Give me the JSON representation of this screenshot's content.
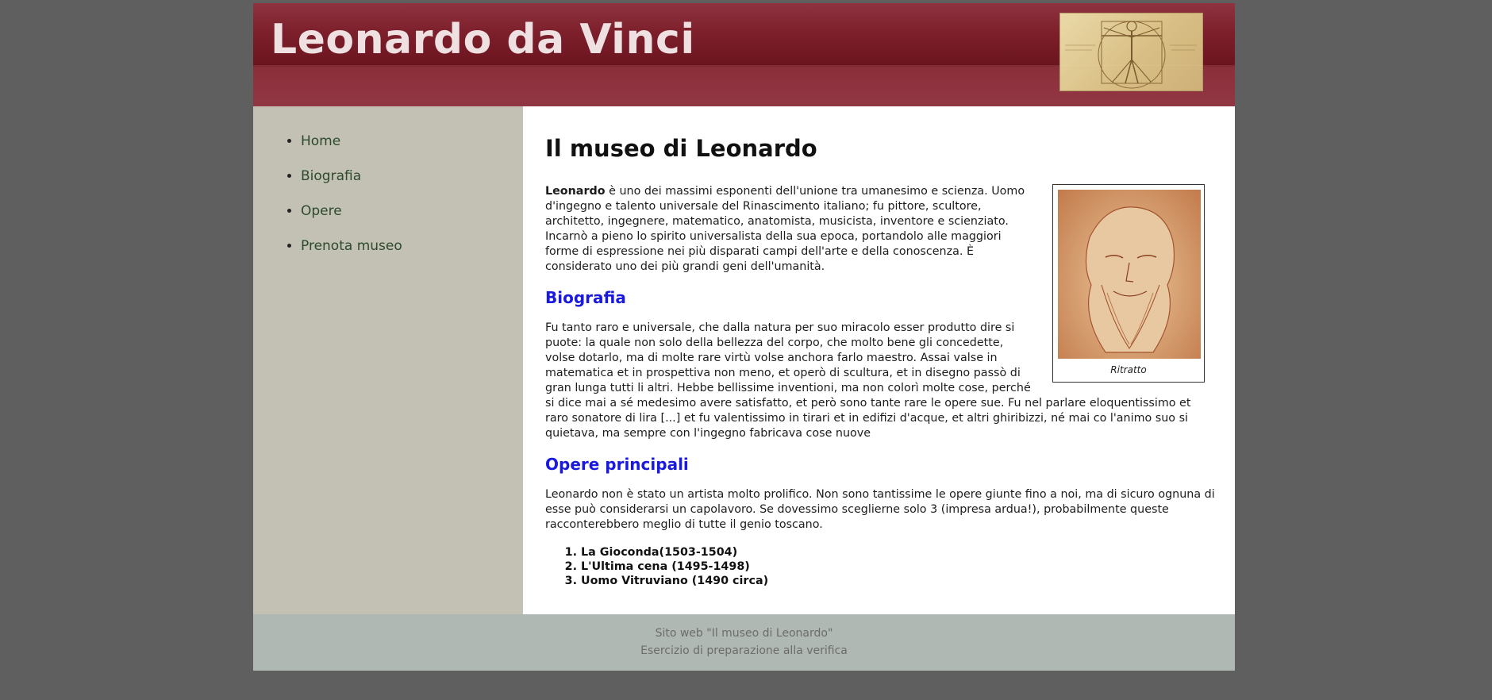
{
  "header": {
    "title": "Leonardo da Vinci"
  },
  "nav": {
    "items": [
      {
        "label": "Home"
      },
      {
        "label": "Biografia"
      },
      {
        "label": "Opere"
      },
      {
        "label": "Prenota museo"
      }
    ]
  },
  "main": {
    "title": "Il museo di Leonardo",
    "intro_bold": "Leonardo",
    "intro_text": " è uno dei massimi esponenti dell'unione tra umanesimo e scienza. Uomo d'ingegno e talento universale del Rinascimento italiano; fu pittore, scultore, architetto, ingegnere, matematico, anatomista, musicista, inventore e scienziato. Incarnò a pieno lo spirito universalista della sua epoca, portandolo alle maggiori forme di espressione nei più disparati campi dell'arte e della conoscenza. È considerato uno dei più grandi geni dell'umanità.",
    "portrait_caption": "Ritratto",
    "bio_heading": "Biografia",
    "bio_text": "Fu tanto raro e universale, che dalla natura per suo miracolo esser produtto dire si puote: la quale non solo della bellezza del corpo, che molto bene gli concedette, volse dotarlo, ma di molte rare virtù volse anchora farlo maestro. Assai valse in matematica et in prospettiva non meno, et operò di scultura, et in disegno passò di gran lunga tutti li altri. Hebbe bellissime inventioni, ma non colorì molte cose, perché si dice mai a sé medesimo avere satisfatto, et però sono tante rare le opere sue. Fu nel parlare eloquentissimo et raro sonatore di lira [...] et fu valentissimo in tirari et in edifizi d'acque, et altri ghiribizzi, né mai co l'animo suo si quietava, ma sempre con l'ingegno fabricava cose nuove",
    "works_heading": "Opere principali",
    "works_text": "Leonardo non è stato un artista molto prolifico. Non sono tantissime le opere giunte fino a noi, ma di sicuro ognuna di esse può considerarsi un capolavoro. Se dovessimo sceglierne solo 3 (impresa ardua!), probabilmente queste racconterebbero meglio di tutte il genio toscano.",
    "works": [
      "La Gioconda(1503-1504)",
      "L'Ultima cena (1495-1498)",
      "Uomo Vitruviano (1490 circa)"
    ]
  },
  "footer": {
    "line1": "Sito web \"Il museo di Leonardo\"",
    "line2": "Esercizio di preparazione alla verifica"
  },
  "colors": {
    "background": "#5f5f5f",
    "header": "#7c1f2b",
    "sidebar": "#c3c1b4",
    "heading_blue": "#1a1adf",
    "footer": "#b0b8b3"
  }
}
